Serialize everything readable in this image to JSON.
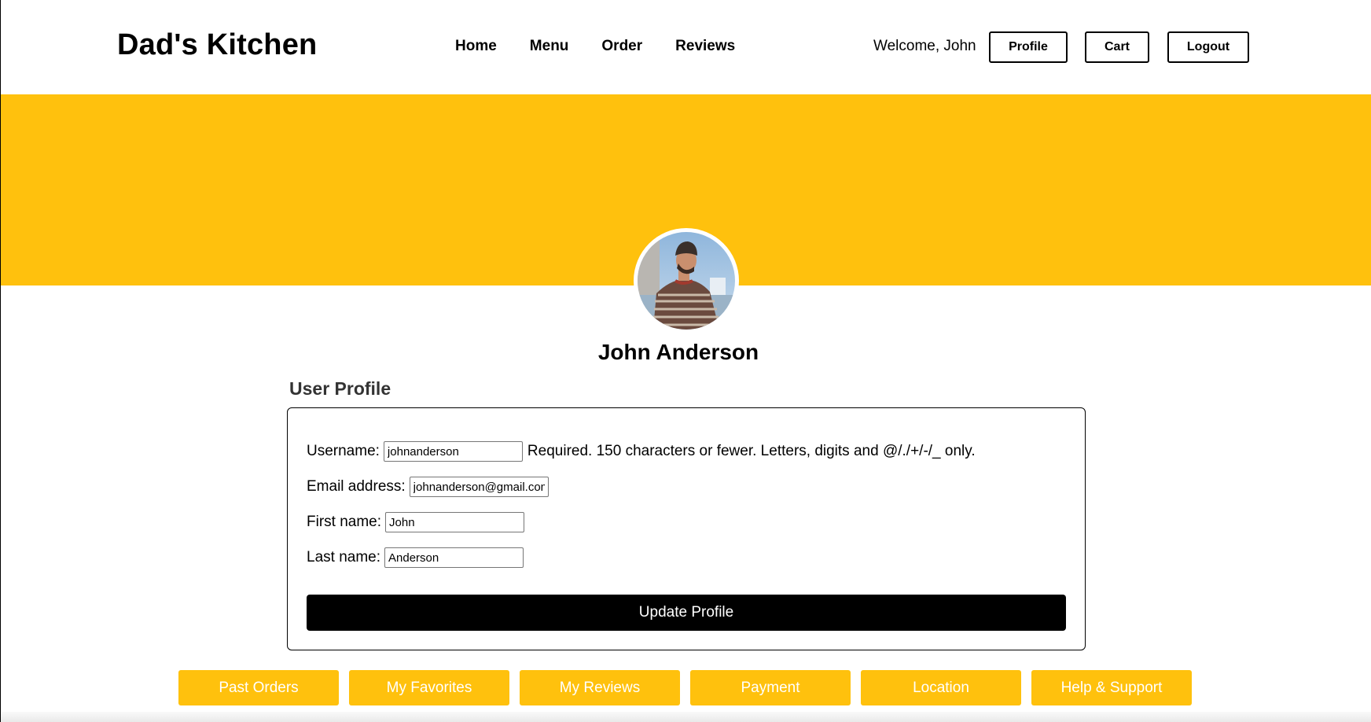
{
  "header": {
    "brand": "Dad's Kitchen",
    "nav": [
      "Home",
      "Menu",
      "Order",
      "Reviews"
    ],
    "welcome": "Welcome, John",
    "buttons": {
      "profile": "Profile",
      "cart": "Cart",
      "logout": "Logout"
    }
  },
  "profile": {
    "name": "John Anderson",
    "section_title": "User Profile",
    "avatar_icon": "user-photo"
  },
  "form": {
    "username": {
      "label": "Username:",
      "value": "johnanderson",
      "help": "Required. 150 characters or fewer. Letters, digits and @/./+/-/_ only."
    },
    "email": {
      "label": "Email address:",
      "value": "johnanderson@gmail.com"
    },
    "first_name": {
      "label": "First name:",
      "value": "John"
    },
    "last_name": {
      "label": "Last name:",
      "value": "Anderson"
    },
    "submit": "Update Profile"
  },
  "tabs": [
    "Past Orders",
    "My Favorites",
    "My Reviews",
    "Payment",
    "Location",
    "Help & Support"
  ],
  "colors": {
    "accent": "#ffc10d",
    "button_dark": "#000000"
  }
}
